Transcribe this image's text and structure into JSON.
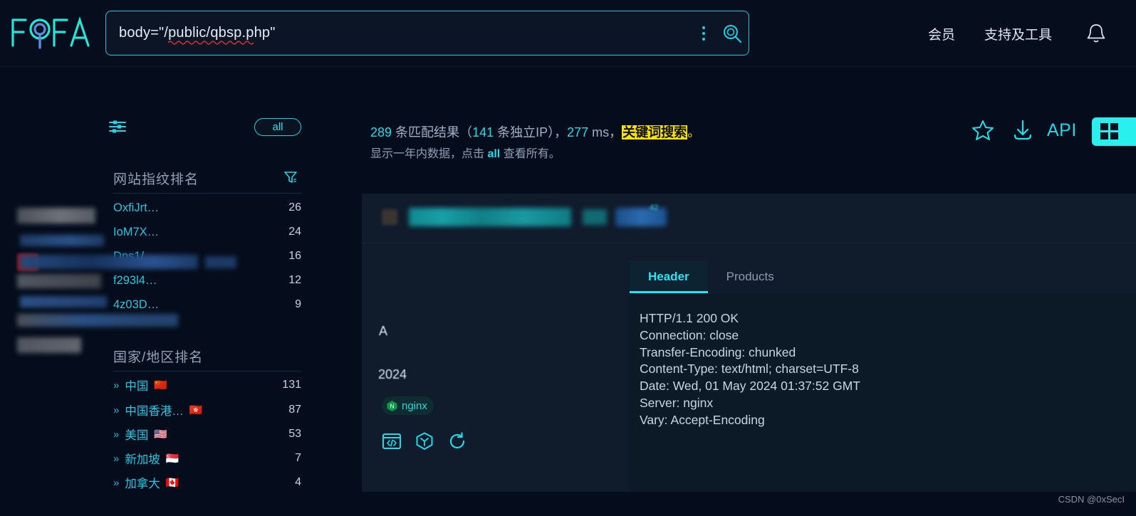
{
  "header": {
    "logo_text": "FOFA",
    "logo_icon": "fofa-logo",
    "search_value": "body=\"/public/qbsp.php\"",
    "search_placeholder": "",
    "more_icon": "kebab-menu-icon",
    "search_icon": "search-magnifier-icon",
    "nav": [
      {
        "label": "会员",
        "name": "nav-member"
      },
      {
        "label": "支持及工具",
        "name": "nav-support"
      }
    ],
    "bell_icon": "bell-icon"
  },
  "sidebar": {
    "filter_icon": "sliders-filter-icon",
    "all_button": "all",
    "fingerprint": {
      "title": "网站指纹排名",
      "filter_icon": "funnel-filter-icon",
      "rows": [
        {
          "name": "OxfiJrt…",
          "count": "26"
        },
        {
          "name": "IoM7X…",
          "count": "24"
        },
        {
          "name": "Dps1/…",
          "count": "16"
        },
        {
          "name": "f293l4…",
          "count": "12"
        },
        {
          "name": "4z03D…",
          "count": "9"
        }
      ]
    },
    "country": {
      "title": "国家/地区排名",
      "rows": [
        {
          "chevron": "»",
          "name": "中国",
          "flag": "🇨🇳",
          "count": "131"
        },
        {
          "chevron": "»",
          "name": "中国香港…",
          "flag": "🇭🇰",
          "count": "87"
        },
        {
          "chevron": "»",
          "name": "美国",
          "flag": "🇺🇸",
          "count": "53"
        },
        {
          "chevron": "»",
          "name": "新加坡",
          "flag": "🇸🇬",
          "count": "7"
        },
        {
          "chevron": "»",
          "name": "加拿大",
          "flag": "🇨🇦",
          "count": "4"
        }
      ]
    }
  },
  "summary": {
    "match_count": "289",
    "match_label_a": " 条匹配结果（",
    "unique_ip": "141",
    "match_label_b": " 条独立IP），",
    "time_ms": "277",
    "time_unit": " ms，",
    "search_mode": "关键词搜索",
    "period_mark": "。",
    "note_prefix": "显示一年内数据，点击 ",
    "note_all": "all",
    "note_suffix": " 查看所有。"
  },
  "tools": {
    "star_icon": "star-favorite-icon",
    "download_icon": "download-icon",
    "api_label": "API",
    "grid_icon": "grid-view-icon"
  },
  "result": {
    "badge_number": "42",
    "tabs": [
      {
        "label": "Header",
        "active": true
      },
      {
        "label": "Products",
        "active": false
      }
    ],
    "product_tag": "nginx",
    "product_icon": "nginx-hexagon-icon",
    "action_icons": [
      {
        "name": "source-code-icon"
      },
      {
        "name": "cube-product-icon"
      },
      {
        "name": "refresh-icon"
      }
    ],
    "ghost_text_1": "A",
    "ghost_text_2": "2024",
    "headers": [
      "HTTP/1.1 200 OK",
      "Connection: close",
      "Transfer-Encoding: chunked",
      "Content-Type: text/html; charset=UTF-8",
      "Date: Wed, 01 May 2024 01:37:52 GMT",
      "Server: nginx",
      "Vary: Accept-Encoding"
    ]
  },
  "watermark": "CSDN @0xSecI",
  "colors": {
    "page_bg": "#050d1c",
    "accent_cyan": "#23dbe8",
    "highlight_yellow": "#f6e400",
    "card_bg": "#101b2c",
    "panel_bg": "#0c1a28"
  }
}
